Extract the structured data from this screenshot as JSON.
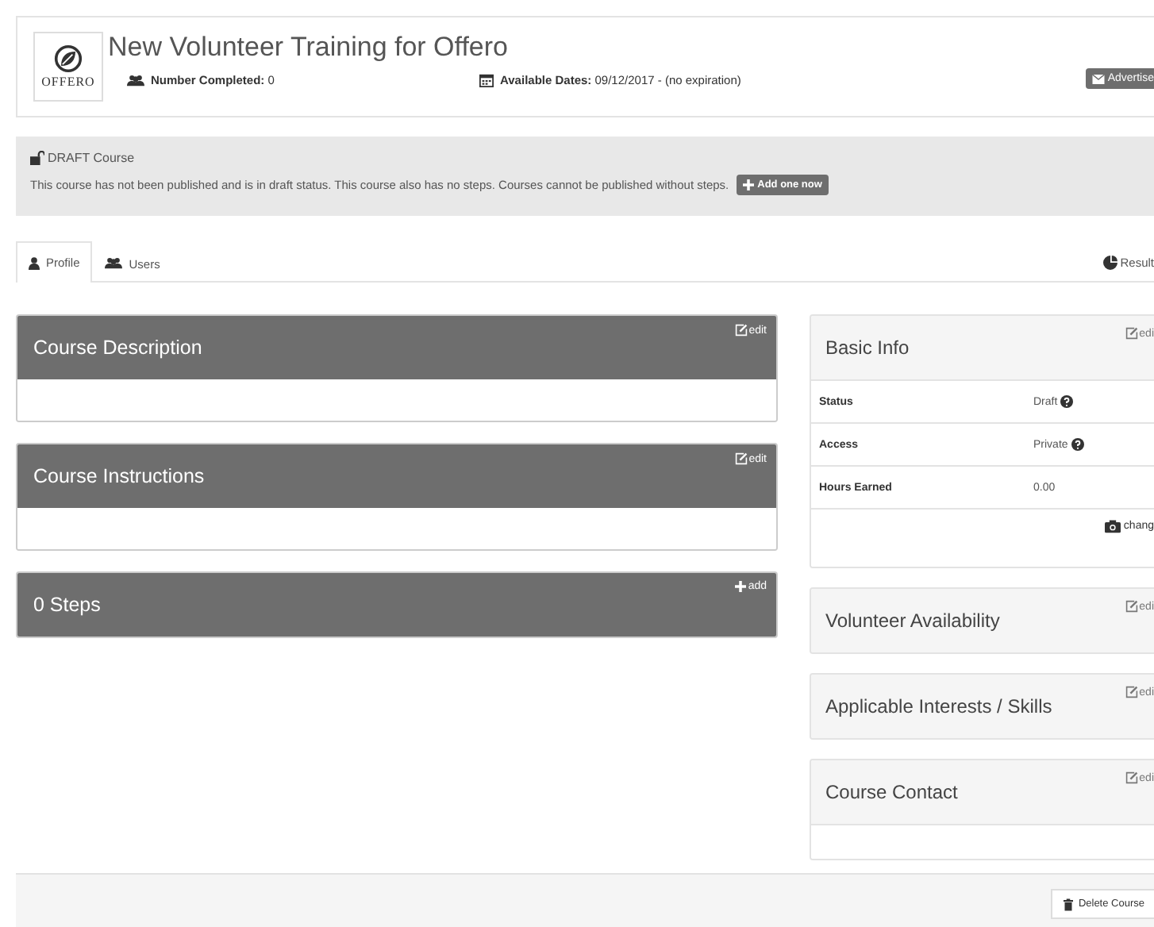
{
  "header": {
    "title": "New Volunteer Training for Offero",
    "logo_text": "OFFERO",
    "stats": [
      {
        "kind": "users",
        "label": "Number Completed:",
        "value": "0"
      },
      {
        "kind": "calendar",
        "label": "Available Dates:",
        "value": "09/12/2017 - (no expiration)"
      }
    ],
    "advertise_button": "Advertise"
  },
  "draft_notice": {
    "title": "DRAFT Course",
    "message": "This course has not been published and is in draft status. This course also has no steps. Courses cannot be published without steps.",
    "button": "Add one now"
  },
  "tabs": [
    {
      "label": "Profile",
      "kind": "person",
      "selected": true
    },
    {
      "label": "Users",
      "kind": "users",
      "selected": false
    }
  ],
  "results_link": "Result",
  "main_panels": [
    {
      "title": "Course Description",
      "kind": "edit",
      "action": "edit"
    },
    {
      "title": "Course Instructions",
      "kind": "edit",
      "action": "edit"
    },
    {
      "title": "0 Steps",
      "kind": "add",
      "action": "add"
    }
  ],
  "side_panels": [
    {
      "title": "Basic Info",
      "action": "edi",
      "body": false,
      "rows": [
        {
          "label": "Status",
          "value": "Draft",
          "help": true
        },
        {
          "label": "Access",
          "value": "Private",
          "help": true
        },
        {
          "label": "Hours Earned",
          "value": "0.00",
          "help": false
        }
      ],
      "footer_action": "chang"
    },
    {
      "title": "Volunteer Availability",
      "action": "edi",
      "body": false
    },
    {
      "title": "Applicable Interests / Skills",
      "action": "edi",
      "body": false
    },
    {
      "title": "Course Contact",
      "action": "edi",
      "body": true
    }
  ],
  "footer": {
    "delete_button": "Delete Course"
  }
}
